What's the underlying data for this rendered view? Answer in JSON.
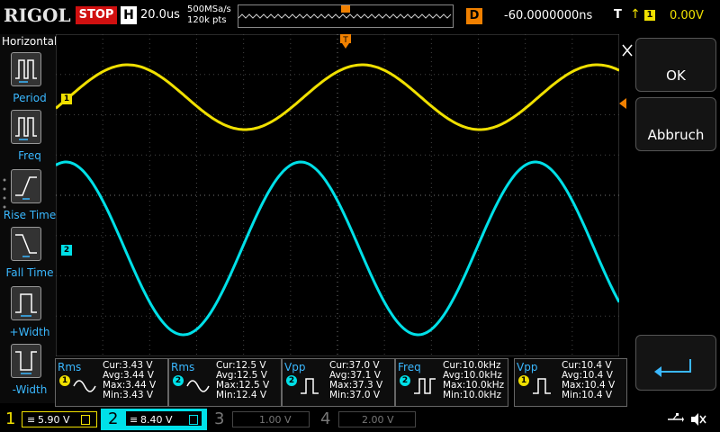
{
  "header": {
    "logo": "RIGOL",
    "run_state": "STOP",
    "timebase_letter": "H",
    "timebase_value": "20.0us",
    "sample_rate": "500MSa/s",
    "memory_depth": "120k pts",
    "delay_letter": "D",
    "delay_value": "-60.0000000ns",
    "trigger_letter": "T",
    "trigger_source": "1",
    "trigger_level": "0.00V"
  },
  "left_menu": {
    "title": "Horizontal",
    "items": [
      {
        "label": "Period"
      },
      {
        "label": "Freq"
      },
      {
        "label": "Rise Time"
      },
      {
        "label": "Fall Time"
      },
      {
        "label": "+Width"
      },
      {
        "label": "-Width"
      }
    ]
  },
  "right_panel": {
    "ok_label": "OK",
    "cancel_label": "Abbruch"
  },
  "channel_markers": {
    "ch1": "1",
    "ch2": "2"
  },
  "measurements": [
    {
      "name": "Rms",
      "channel": "1",
      "cur": "Cur:3.43 V",
      "avg": "Avg:3.44 V",
      "max": "Max:3.44 V",
      "min": "Min:3.43 V",
      "color": "#f0e000"
    },
    {
      "name": "Rms",
      "channel": "2",
      "cur": "Cur:12.5 V",
      "avg": "Avg:12.5 V",
      "max": "Max:12.5 V",
      "min": "Min:12.4 V",
      "color": "#00e0e8"
    },
    {
      "name": "Vpp",
      "channel": "2",
      "cur": "Cur:37.0 V",
      "avg": "Avg:37.1 V",
      "max": "Max:37.3 V",
      "min": "Min:37.0 V",
      "color": "#00e0e8"
    },
    {
      "name": "Freq",
      "channel": "2",
      "cur": "Cur:10.0kHz",
      "avg": "Avg:10.0kHz",
      "max": "Max:10.0kHz",
      "min": "Min:10.0kHz",
      "color": "#00e0e8"
    },
    {
      "name": "Vpp",
      "channel": "1",
      "cur": "Cur:10.4 V",
      "avg": "Avg:10.4 V",
      "max": "Max:10.4 V",
      "min": "Min:10.4 V",
      "color": "#f0e000"
    }
  ],
  "channels": [
    {
      "num": "1",
      "scale": "5.90 V",
      "color": "#f0e000",
      "active": true
    },
    {
      "num": "2",
      "scale": "8.40 V",
      "color": "#00e0e8",
      "active": true
    },
    {
      "num": "3",
      "scale": "1.00 V",
      "color": "#777777",
      "active": false
    },
    {
      "num": "4",
      "scale": "2.00 V",
      "color": "#777777",
      "active": false
    }
  ],
  "colors": {
    "ch1": "#f0e000",
    "ch2": "#00e0e8",
    "accent": "#3ab8ff",
    "trigger": "#f08000",
    "stop": "#d01010"
  }
}
